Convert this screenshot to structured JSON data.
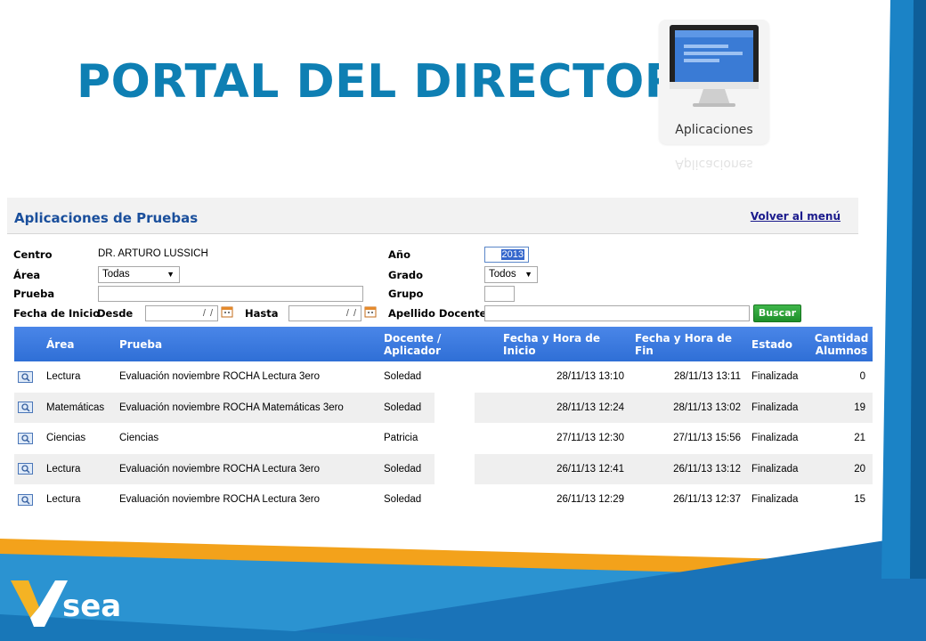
{
  "slide": {
    "title": "PORTAL DEL DIRECTOR",
    "colors": {
      "title": "#0e7fb3",
      "accent_orange": "#f3a21b",
      "accent_blue": "#1b83c6"
    }
  },
  "app_tile": {
    "label": "Aplicaciones",
    "reflection": "Aplicaciones"
  },
  "panel": {
    "title": "Aplicaciones de Pruebas",
    "back_link": "Volver al menú",
    "filters": {
      "centro_label": "Centro",
      "centro_value": "DR. ARTURO LUSSICH",
      "area_label": "Área",
      "area_value": "Todas",
      "prueba_label": "Prueba",
      "prueba_value": "",
      "fecha_label": "Fecha de Inicio",
      "desde_label": "Desde",
      "desde_value": "/ /",
      "hasta_label": "Hasta",
      "hasta_value": "/ /",
      "anio_label": "Año",
      "anio_value": "2013",
      "grado_label": "Grado",
      "grado_value": "Todos",
      "grupo_label": "Grupo",
      "grupo_value": "",
      "apellido_label": "Apellido Docente",
      "apellido_value": "",
      "search_label": "Buscar"
    },
    "table": {
      "headers": [
        "Área",
        "Prueba",
        "Docente / Aplicador",
        "Fecha y Hora de Inicio",
        "Fecha y Hora de Fin",
        "Estado",
        "Cantidad Alumnos"
      ],
      "rows": [
        {
          "area": "Lectura",
          "prueba": "Evaluación noviembre ROCHA Lectura 3ero",
          "docente": "Soledad",
          "inicio": "28/11/13 13:10",
          "fin": "28/11/13 13:11",
          "estado": "Finalizada",
          "cantidad": "0"
        },
        {
          "area": "Matemáticas",
          "prueba": "Evaluación noviembre ROCHA Matemáticas 3ero",
          "docente": "Soledad",
          "inicio": "28/11/13 12:24",
          "fin": "28/11/13 13:02",
          "estado": "Finalizada",
          "cantidad": "19"
        },
        {
          "area": "Ciencias",
          "prueba": "Ciencias",
          "docente": "Patricia",
          "inicio": "27/11/13 12:30",
          "fin": "27/11/13 15:56",
          "estado": "Finalizada",
          "cantidad": "21"
        },
        {
          "area": "Lectura",
          "prueba": "Evaluación noviembre ROCHA Lectura 3ero",
          "docente": "Soledad",
          "inicio": "26/11/13 12:41",
          "fin": "26/11/13 13:12",
          "estado": "Finalizada",
          "cantidad": "20"
        },
        {
          "area": "Lectura",
          "prueba": "Evaluación noviembre ROCHA Lectura 3ero",
          "docente": "Soledad",
          "inicio": "26/11/13 12:29",
          "fin": "26/11/13 12:37",
          "estado": "Finalizada",
          "cantidad": "15"
        }
      ]
    }
  },
  "brand": {
    "logo_text": "sea"
  }
}
